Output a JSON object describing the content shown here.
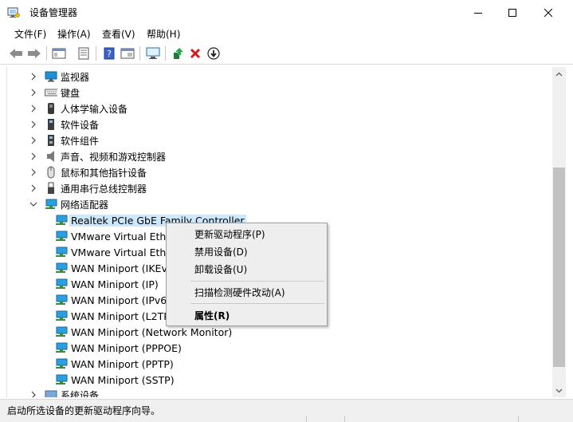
{
  "window": {
    "title": "设备管理器"
  },
  "menu": {
    "items": [
      "文件(F)",
      "操作(A)",
      "查看(V)",
      "帮助(H)"
    ]
  },
  "toolbar": {
    "icons": [
      "back-arrow-icon",
      "forward-arrow-icon",
      "show-hide-tree-icon",
      "properties-icon",
      "help-icon",
      "view-resources-icon",
      "computer-monitor-icon",
      "update-driver-icon",
      "uninstall-x-icon",
      "download-arrow-icon"
    ]
  },
  "tree": {
    "categories": [
      {
        "label": "监视器",
        "icon": "monitor-icon"
      },
      {
        "label": "键盘",
        "icon": "keyboard-icon"
      },
      {
        "label": "人体学输入设备",
        "icon": "hid-icon"
      },
      {
        "label": "软件设备",
        "icon": "software-device-icon"
      },
      {
        "label": "软件组件",
        "icon": "software-component-icon"
      },
      {
        "label": "声音、视频和游戏控制器",
        "icon": "speaker-icon"
      },
      {
        "label": "鼠标和其他指针设备",
        "icon": "mouse-icon"
      },
      {
        "label": "通用串行总线控制器",
        "icon": "usb-icon"
      },
      {
        "label": "网络适配器",
        "icon": "network-adapter-icon"
      }
    ],
    "network_children": [
      "Realtek PCIe GbE Family Controller",
      "VMware Virtual Ethernet Adapter for VMnet1",
      "VMware Virtual Ethernet Adapter for VMnet8",
      "WAN Miniport (IKEv2)",
      "WAN Miniport (IP)",
      "WAN Miniport (IPv6)",
      "WAN Miniport (L2TP)",
      "WAN Miniport (Network Monitor)",
      "WAN Miniport (PPPOE)",
      "WAN Miniport (PPTP)",
      "WAN Miniport (SSTP)"
    ],
    "last_category": "系统设备"
  },
  "context_menu": {
    "update_driver": "更新驱动程序(P)",
    "disable_device": "禁用设备(D)",
    "uninstall_device": "卸载设备(U)",
    "scan_hardware": "扫描检测硬件改动(A)",
    "properties": "属性(R)"
  },
  "status": {
    "text": "启动所选设备的更新驱动程序向导。"
  },
  "colors": {
    "selection": "#cce8ff",
    "scroll_thumb": "#c2c2c2",
    "menu_bg": "#eeeeee"
  }
}
